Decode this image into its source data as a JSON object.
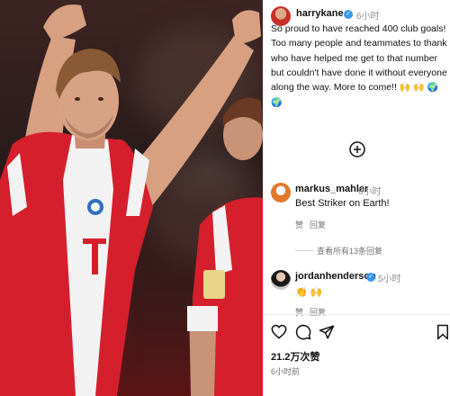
{
  "post": {
    "username": "harrykane",
    "time": "6小时",
    "caption": "So proud to have reached 400 club goals! Too many people and teammates to thank who have helped me get to that number but couldn't have done it without everyone along the way. More to come!!",
    "caption_emojis": [
      "🙌",
      "🙌",
      "🌍",
      "🌍"
    ]
  },
  "load_more_icon": "plus-circle-icon",
  "comments": [
    {
      "username": "markus_mahler",
      "time": "6小时",
      "text": "Best Striker on Earth!",
      "like_label": "赞",
      "reply_label": "回复"
    },
    {
      "username": "jordanhenderson",
      "time": "5小时",
      "emoji_text": [
        "👏",
        "🙌"
      ],
      "like_label": "赞",
      "reply_label": "回复"
    }
  ],
  "view_replies": "查看所有13条回复",
  "actions": {
    "like_icon": "heart-icon",
    "comment_icon": "comment-icon",
    "share_icon": "send-icon",
    "save_icon": "bookmark-icon"
  },
  "likes": "21.2万次赞",
  "posted_time": "6小时前",
  "colors": {
    "verified": "#3897f0",
    "jersey_red": "#d61f2c",
    "jersey_white": "#f2f2f2"
  }
}
